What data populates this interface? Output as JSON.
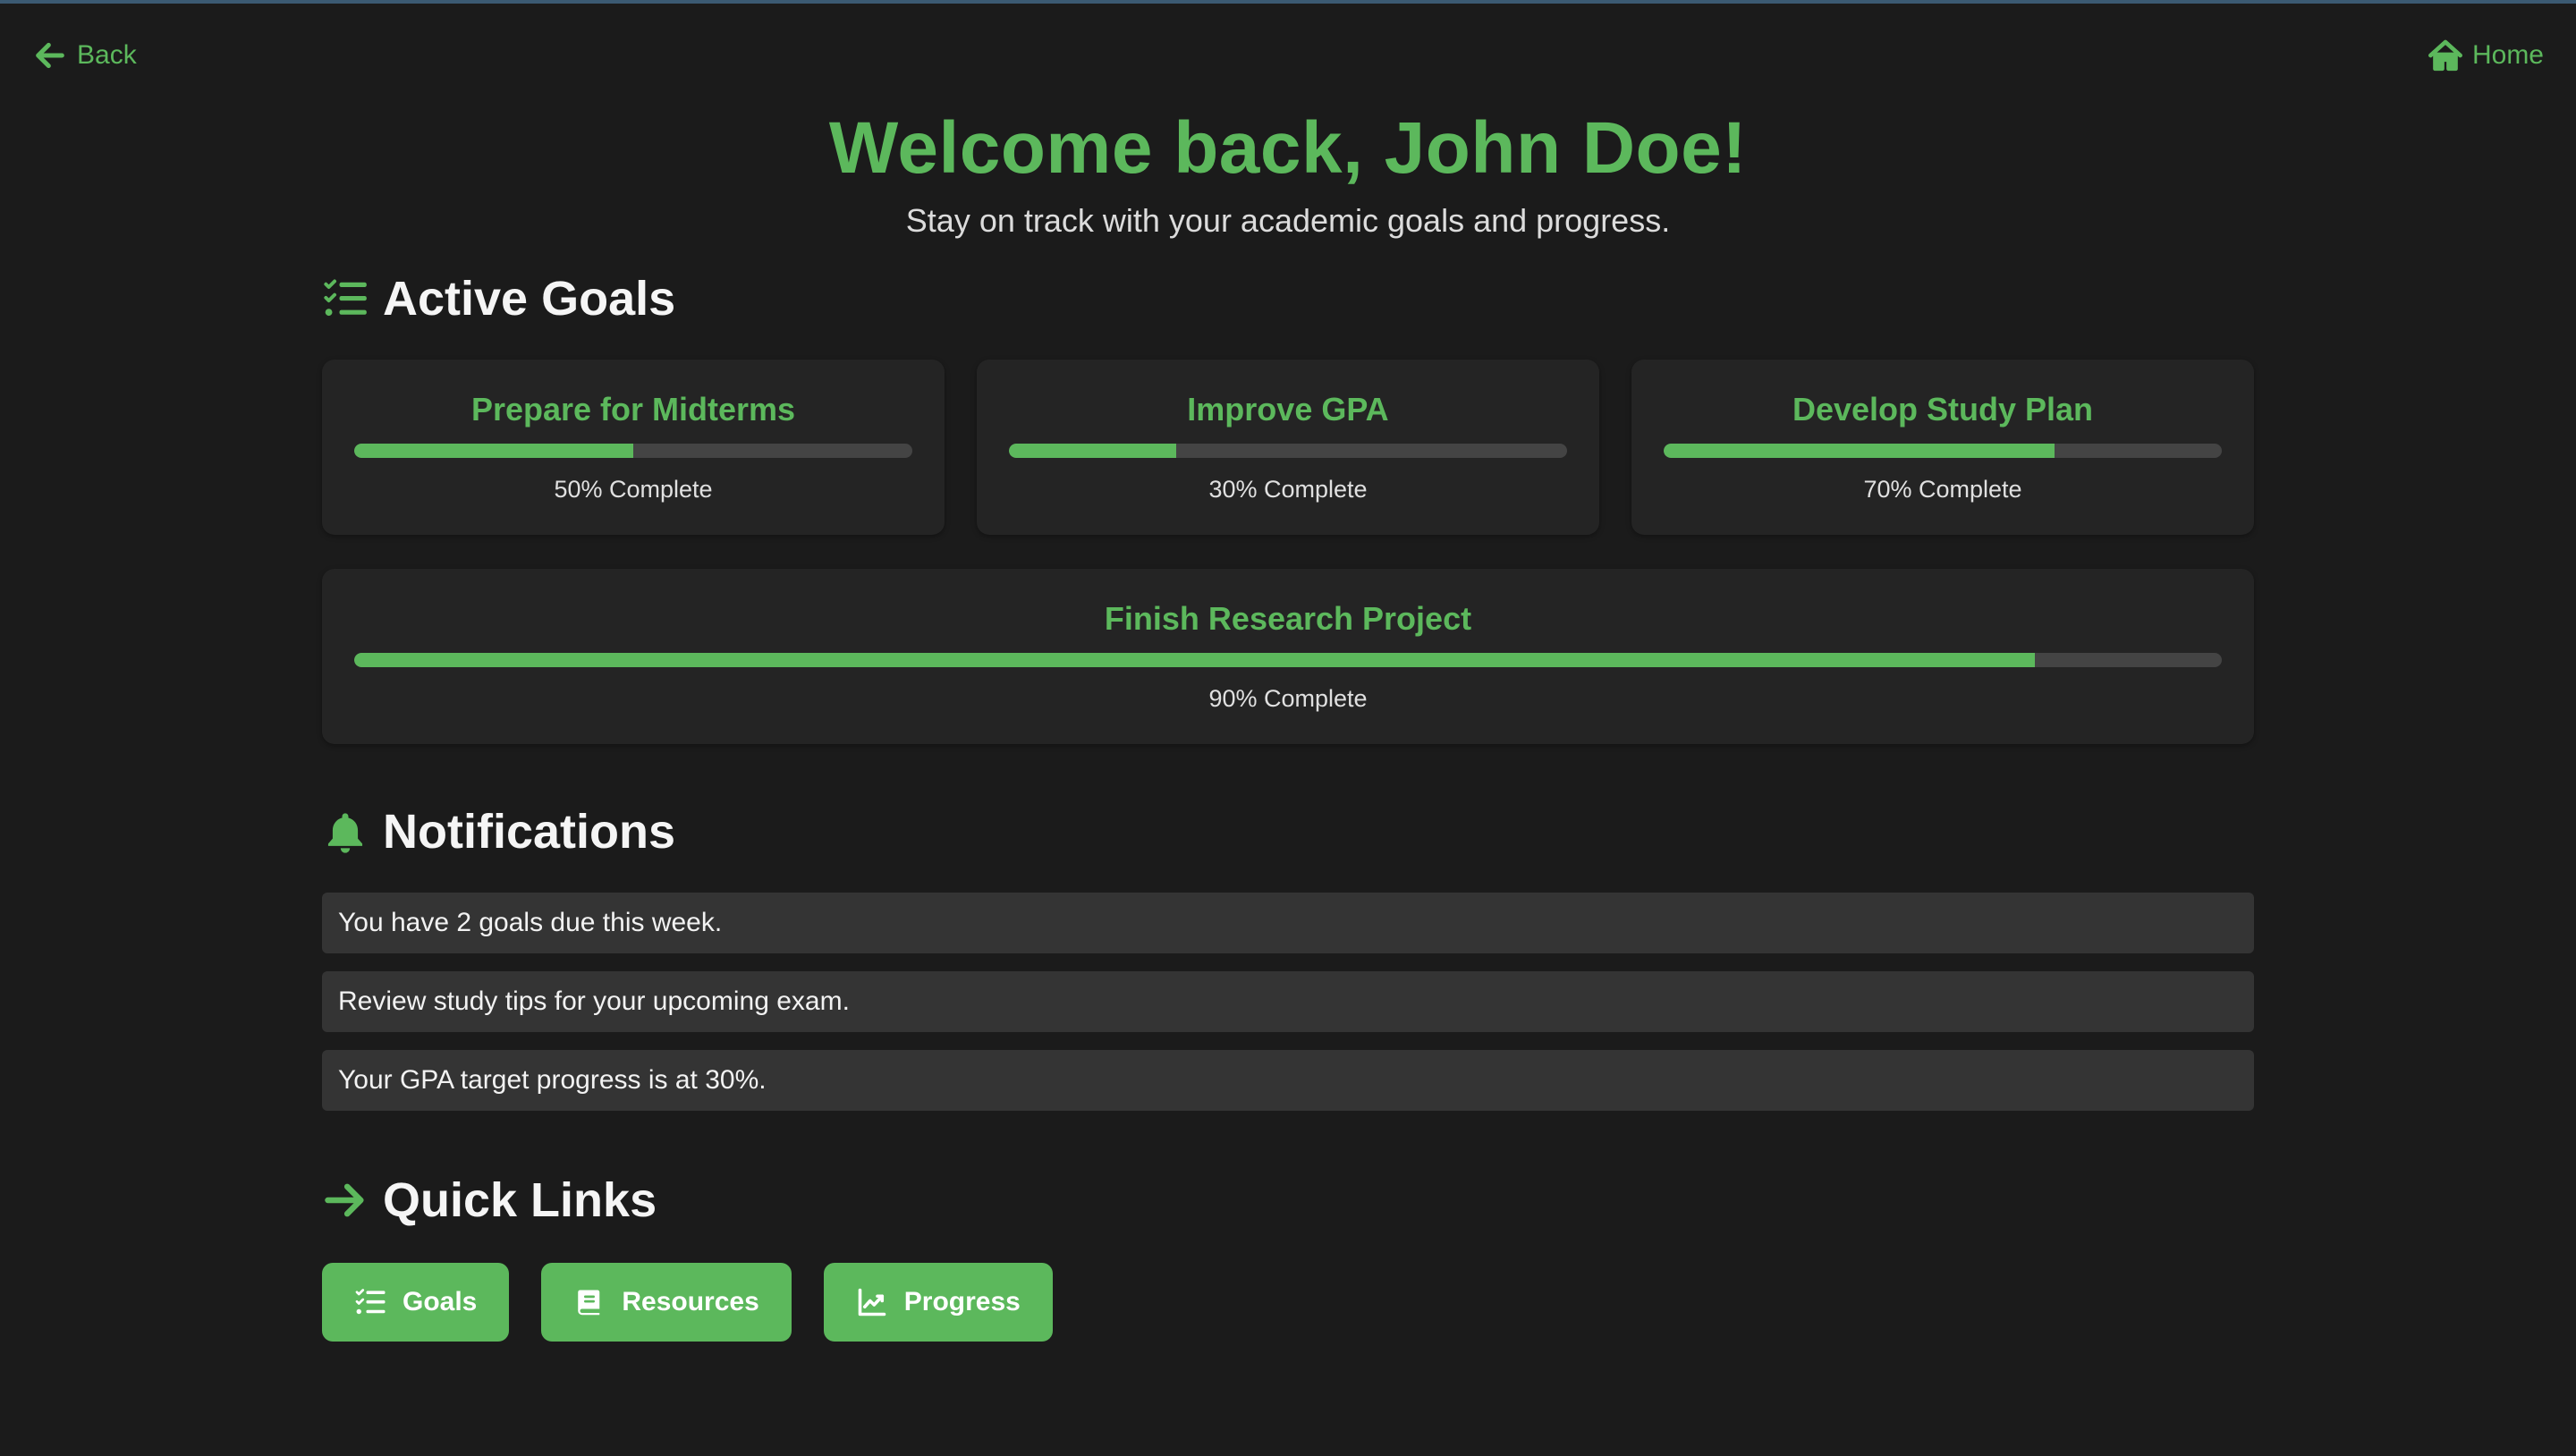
{
  "nav": {
    "back_label": "Back",
    "home_label": "Home"
  },
  "header": {
    "title": "Welcome back, John Doe!",
    "subtitle": "Stay on track with your academic goals and progress."
  },
  "goals": {
    "title": "Active Goals",
    "items": [
      {
        "name": "Prepare for Midterms",
        "percent": 50,
        "label": "50% Complete"
      },
      {
        "name": "Improve GPA",
        "percent": 30,
        "label": "30% Complete"
      },
      {
        "name": "Develop Study Plan",
        "percent": 70,
        "label": "70% Complete"
      },
      {
        "name": "Finish Research Project",
        "percent": 90,
        "label": "90% Complete"
      }
    ]
  },
  "notifications": {
    "title": "Notifications",
    "items": [
      "You have 2 goals due this week.",
      "Review study tips for your upcoming exam.",
      "Your GPA target progress is at 30%."
    ]
  },
  "quick_links": {
    "title": "Quick Links",
    "items": [
      {
        "label": "Goals",
        "icon": "list-check-icon"
      },
      {
        "label": "Resources",
        "icon": "book-icon"
      },
      {
        "label": "Progress",
        "icon": "chart-line-icon"
      }
    ]
  },
  "colors": {
    "accent": "#5cb85c",
    "background": "#1b1b1b",
    "card": "#242424",
    "notification": "#343434"
  }
}
